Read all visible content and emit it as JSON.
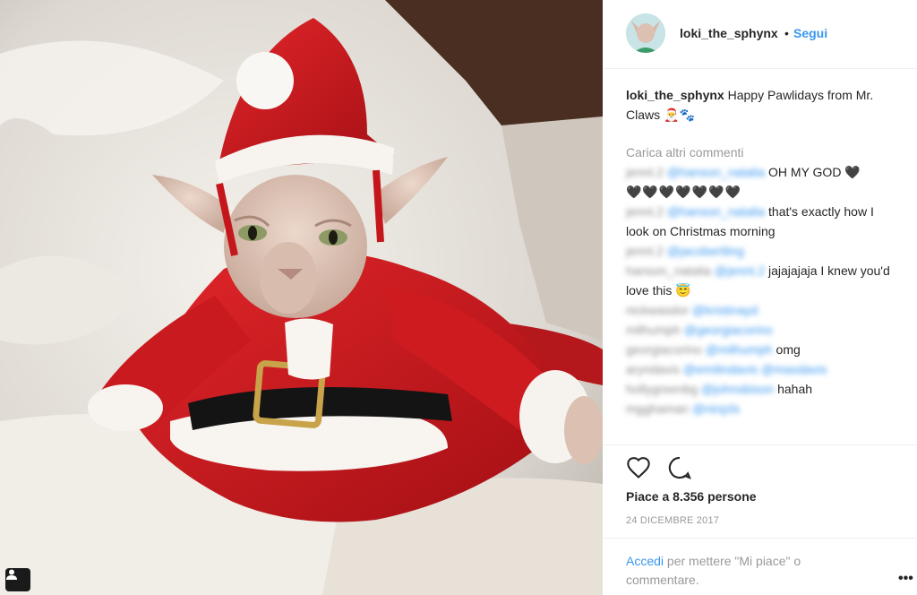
{
  "post": {
    "username": "loki_the_sphynx",
    "follow_label": "Segui",
    "separator": "•",
    "caption_text": "Happy Pawlidays from Mr. Claws 🎅🐾",
    "load_more": "Carica altri commenti",
    "comments": [
      {
        "user": "jennt.2",
        "mention": "@hanson_natalia",
        "text": "OH MY GOD 🖤"
      },
      {
        "user": "",
        "mention": "",
        "text": "🖤🖤🖤🖤🖤🖤🖤"
      },
      {
        "user": "jennt.2",
        "mention": "@hanson_natalia",
        "text": "that's exactly how I look on Christmas morning"
      },
      {
        "user": "jennt.2",
        "mention": "@jacobertling",
        "text": ""
      },
      {
        "user": "hanson_natalia",
        "mention": "@jennt.2",
        "text": "jajajajaja I knew you'd love this 😇"
      },
      {
        "user": "nickwasdor",
        "mention": "@kristinayd",
        "text": ""
      },
      {
        "user": "milhumph",
        "mention": "@georgiacorino",
        "text": ""
      },
      {
        "user": "georgiacorino",
        "mention": "@milhumph",
        "text": "omg"
      },
      {
        "user": "aryndavis",
        "mention": "@emilindavis @maxdavis",
        "text": ""
      },
      {
        "user": "hollygreenbg",
        "mention": "@johnsbison",
        "text": "hahah"
      },
      {
        "user": "mgghaman",
        "mention": "@ninjzls",
        "text": ""
      }
    ],
    "likes": "Piace a 8.356 persone",
    "date": "24 DICEMBRE 2017",
    "login_link": "Accedi",
    "login_text": "per mettere \"Mi piace\" o commentare.",
    "more_label": "•••"
  },
  "icons": {
    "like": "heart-icon",
    "comment": "comment-icon",
    "tag": "user-tag-icon",
    "more": "more-options-icon"
  },
  "colors": {
    "link": "#3897f0",
    "text": "#262626",
    "muted": "#999999"
  }
}
